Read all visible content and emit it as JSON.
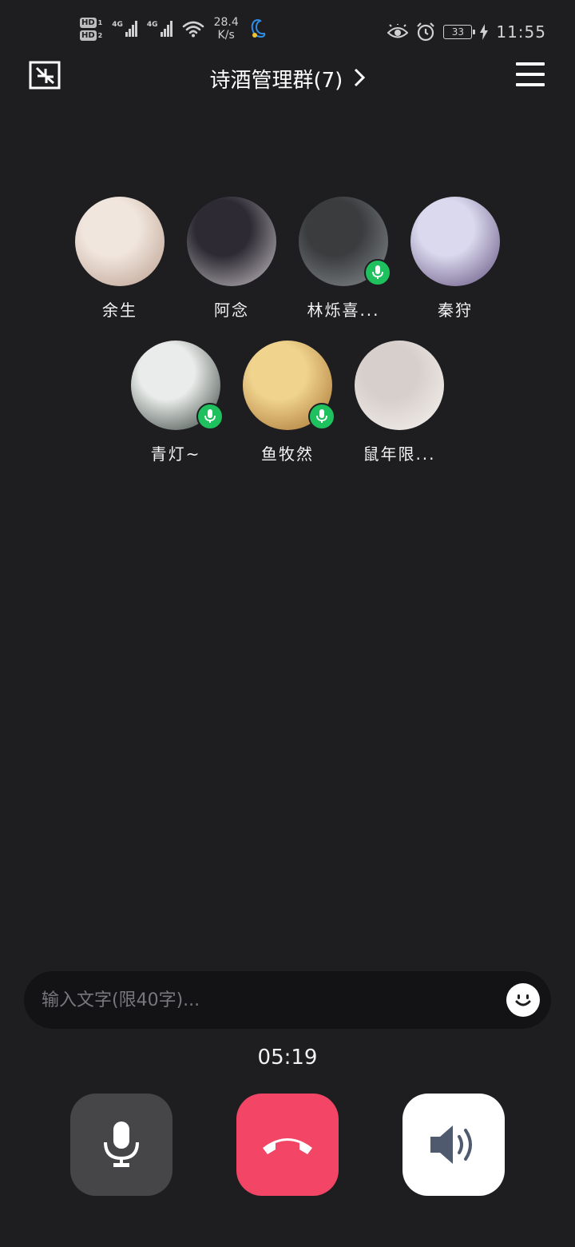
{
  "status_bar": {
    "hd1": "HD",
    "hd1_sim": "1",
    "hd2": "HD",
    "hd2_sim": "2",
    "net1": "4G",
    "net2": "4G",
    "speed_value": "28.4",
    "speed_unit": "K/s",
    "battery": "33",
    "time": "11:55",
    "icons": [
      "eye-comfort-icon",
      "alarm-icon",
      "charging-icon",
      "wifi-icon",
      "app-notification-icon"
    ]
  },
  "header": {
    "title": "诗酒管理群(7)"
  },
  "members": [
    {
      "name": "余生",
      "mic_on": false,
      "colors": [
        "#f1e6de",
        "#b99c8b"
      ]
    },
    {
      "name": "阿念",
      "mic_on": false,
      "colors": [
        "#2d2a33",
        "#c9c3c8"
      ]
    },
    {
      "name": "林烁喜...",
      "mic_on": true,
      "colors": [
        "#3a3c3e",
        "#8a8f92"
      ]
    },
    {
      "name": "秦狩",
      "mic_on": false,
      "colors": [
        "#dad9ee",
        "#5f4c7a"
      ]
    },
    {
      "name": "青灯~",
      "mic_on": true,
      "colors": [
        "#e9ecea",
        "#2f3a35"
      ]
    },
    {
      "name": "鱼牧然",
      "mic_on": true,
      "colors": [
        "#f0d48e",
        "#a46d2d"
      ]
    },
    {
      "name": "鼠年限...",
      "mic_on": false,
      "colors": [
        "#d7cfcb",
        "#f7f3f1"
      ]
    }
  ],
  "input": {
    "placeholder": "输入文字(限40字)..."
  },
  "call": {
    "timer": "05:19"
  },
  "colors": {
    "background": "#1e1e21",
    "mic_active": "#1fc15f",
    "hangup": "#f34565",
    "mic_button": "#464649",
    "speaker_button": "#ffffff"
  }
}
